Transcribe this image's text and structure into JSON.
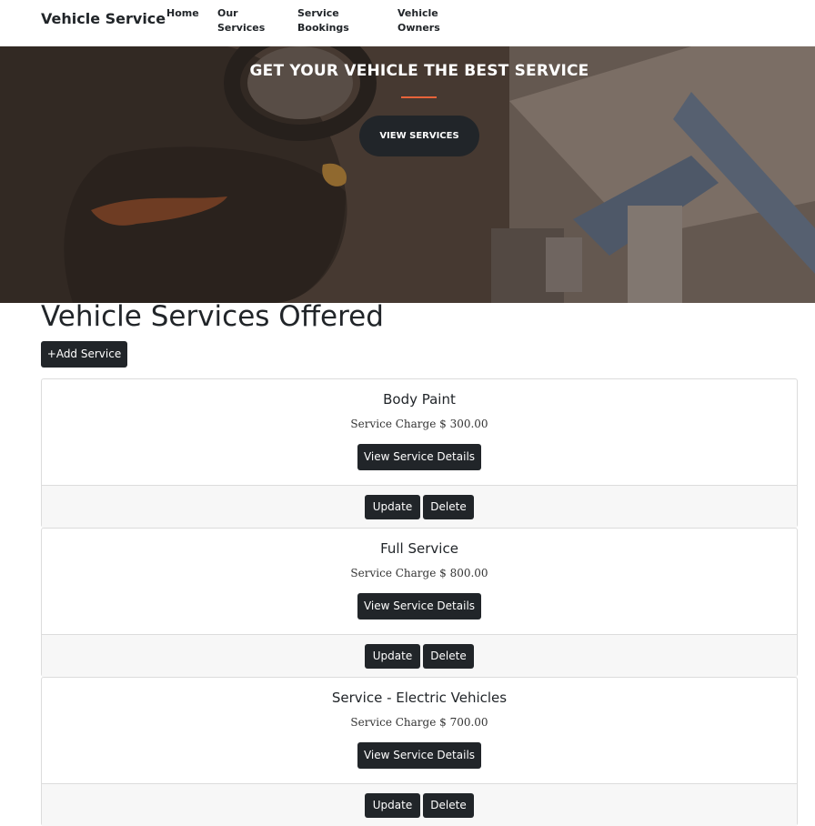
{
  "navbar": {
    "brand": "Vehicle Service",
    "links": [
      "Home",
      "Our\nServices",
      "Service\nBookings",
      "Vehicle\nOwners"
    ]
  },
  "hero": {
    "title": "GET YOUR VEHICLE THE BEST SERVICE",
    "button_label": "VIEW SERVICES",
    "accent_color": "#e8633a"
  },
  "main": {
    "title": "Vehicle Services Offered",
    "add_button_label": "+Add Service"
  },
  "services": [
    {
      "name": "Body Paint",
      "charge_text": "Service Charge $ 300.00",
      "details_label": "View Service Details",
      "update_label": "Update",
      "delete_label": "Delete"
    },
    {
      "name": "Full Service",
      "charge_text": "Service Charge $ 800.00",
      "details_label": "View Service Details",
      "update_label": "Update",
      "delete_label": "Delete"
    },
    {
      "name": "Service - Electric Vehicles",
      "charge_text": "Service Charge $ 700.00",
      "details_label": "View Service Details",
      "update_label": "Update",
      "delete_label": "Delete"
    }
  ]
}
